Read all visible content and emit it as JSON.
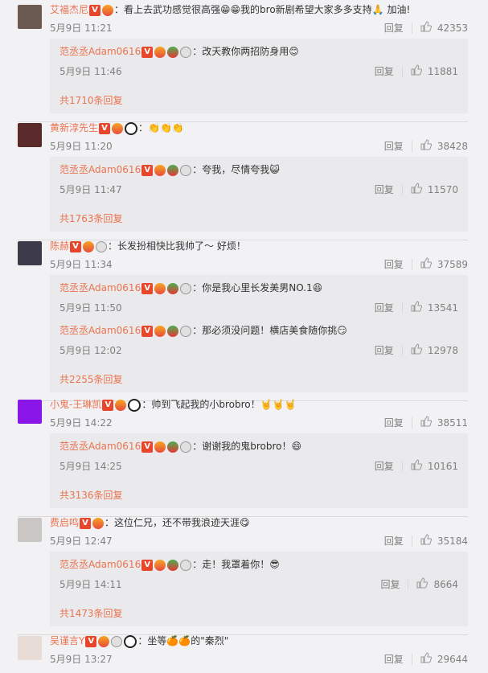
{
  "ui": {
    "reply": "回复",
    "comment_sep": "："
  },
  "comments": [
    {
      "user": "艾福杰尼",
      "text": "看上去武功感觉很高强😁😁我的bro新剧希望大家多多支持🙏 加油!",
      "time": "5月9日 11:21",
      "likes": "42353",
      "avatar_color": "#6b5a52",
      "replies": [
        {
          "user": "范丞丞Adam0616",
          "text": "改天教你两招防身用😊",
          "time": "5月9日 11:46",
          "likes": "11881"
        }
      ],
      "more": "共1710条回复"
    },
    {
      "user": "黄新淳先生",
      "text": "👏👏👏",
      "time": "5月9日 11:20",
      "likes": "38428",
      "avatar_color": "#5a2a2a",
      "replies": [
        {
          "user": "范丞丞Adam0616",
          "text": "夸我，尽情夸我😺",
          "time": "5月9日 11:47",
          "likes": "11570"
        }
      ],
      "more": "共1763条回复"
    },
    {
      "user": "陈赫",
      "text": "长发扮相快比我帅了～ 好烦！",
      "time": "5月9日 11:34",
      "likes": "37589",
      "avatar_color": "#3d3a4a",
      "replies": [
        {
          "user": "范丞丞Adam0616",
          "text": "你是我心里长发美男NO.1😆",
          "time": "5月9日 11:50",
          "likes": "13541"
        },
        {
          "user": "范丞丞Adam0616",
          "text": "那必须没问题！横店美食随你挑😏",
          "time": "5月9日 12:02",
          "likes": "12978"
        }
      ],
      "more": "共2255条回复"
    },
    {
      "user": "小鬼-王琳凯",
      "text": "帅到飞起我的小brobro！🤘🤘🤘",
      "time": "5月9日 14:22",
      "likes": "38511",
      "avatar_color": "#8b16e8",
      "replies": [
        {
          "user": "范丞丞Adam0616",
          "text": "谢谢我的鬼brobro！😄",
          "time": "5月9日 14:25",
          "likes": "10161"
        }
      ],
      "more": "共3136条回复"
    },
    {
      "user": "费启鸣",
      "text": "这位仁兄，还不带我浪迹天涯😋",
      "time": "5月9日 12:47",
      "likes": "35184",
      "avatar_color": "#c9c6c4",
      "replies": [
        {
          "user": "范丞丞Adam0616",
          "text": "走！我罩着你！😎",
          "time": "5月9日 14:11",
          "likes": "8664"
        }
      ],
      "more": "共1473条回复"
    },
    {
      "user": "吴谨言Y",
      "text": "坐等🍊🍊的\"秦烈\"",
      "time": "5月9日 13:27",
      "likes": "29644",
      "avatar_color": "#e8dcd6",
      "replies": [],
      "more": ""
    }
  ],
  "colors": {
    "username": "#eb7350",
    "meta": "#808080",
    "reply_bg": "#eaeaec",
    "page_bg": "#f2f2f5"
  }
}
